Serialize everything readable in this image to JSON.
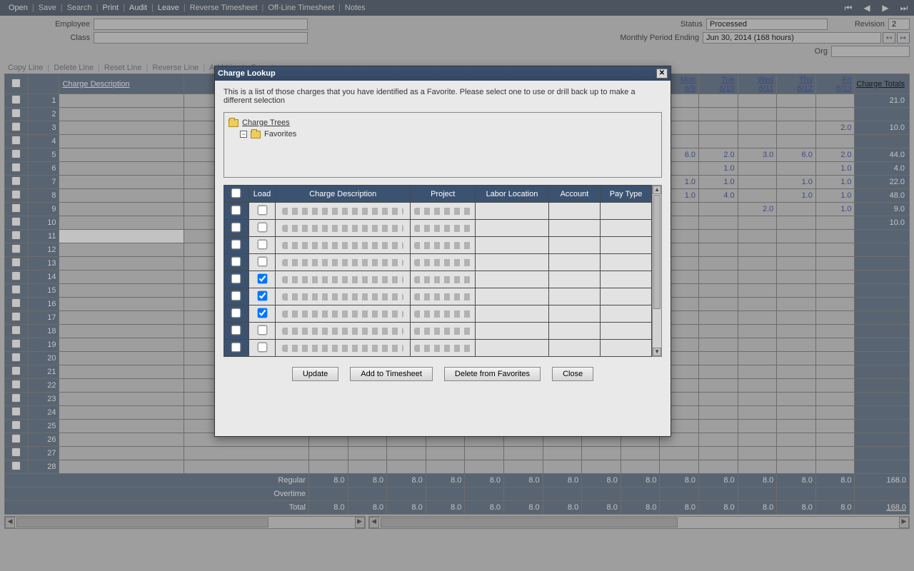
{
  "toolbar": {
    "items": [
      "Open",
      "Save",
      "Search",
      "Print",
      "Audit",
      "Leave",
      "Reverse Timesheet",
      "Off-Line Timesheet",
      "Notes"
    ],
    "active": [
      true,
      false,
      false,
      true,
      true,
      true,
      false,
      false,
      false
    ]
  },
  "info": {
    "employee_label": "Employee",
    "employee_value": "",
    "class_label": "Class",
    "class_value": "",
    "status_label": "Status",
    "status_value": "Processed",
    "revision_label": "Revision",
    "revision_value": "2",
    "period_label": "Monthly Period Ending",
    "period_value": "Jun 30, 2014 (168 hours)",
    "org_label": "Org",
    "org_value": ""
  },
  "line_actions": [
    "Copy Line",
    "Delete Line",
    "Reset Line",
    "Reverse Line",
    "Add Line to Favorites"
  ],
  "ts_header": {
    "charge_desc": "Charge Description",
    "mon": "Mon",
    "mon_d": "6/9",
    "tue": "Tue",
    "tue_d": "6/10",
    "wed": "Wed",
    "wed_d": "6/11",
    "thu": "Thu",
    "thu_d": "6/12",
    "fri": "Fri",
    "fri_d": "6/13",
    "totals": "Charge Totals"
  },
  "rows": [
    {
      "n": "1",
      "mon": "",
      "tue": "",
      "wed": "",
      "thu": "",
      "fri": "",
      "tot": "21.0"
    },
    {
      "n": "2",
      "mon": "",
      "tue": "",
      "wed": "",
      "thu": "",
      "fri": "",
      "tot": ""
    },
    {
      "n": "3",
      "mon": "",
      "tue": "",
      "wed": "",
      "thu": "",
      "fri": "2.0",
      "tot": "10.0"
    },
    {
      "n": "4",
      "mon": "",
      "tue": "",
      "wed": "",
      "thu": "",
      "fri": "",
      "tot": ""
    },
    {
      "n": "5",
      "mon": "6.0",
      "tue": "2.0",
      "wed": "3.0",
      "thu": "6.0",
      "fri": "2.0",
      "tot": "44.0"
    },
    {
      "n": "6",
      "mon": "",
      "tue": "1.0",
      "wed": "",
      "thu": "",
      "fri": "1.0",
      "tot": "4.0"
    },
    {
      "n": "7",
      "mon": "1.0",
      "tue": "1.0",
      "wed": "",
      "thu": "1.0",
      "fri": "1.0",
      "tot": "22.0"
    },
    {
      "n": "8",
      "mon": "1.0",
      "tue": "4.0",
      "wed": "",
      "thu": "1.0",
      "fri": "1.0",
      "tot": "48.0"
    },
    {
      "n": "9",
      "mon": "",
      "tue": "",
      "wed": "2.0",
      "thu": "",
      "fri": "1.0",
      "tot": "9.0"
    },
    {
      "n": "10",
      "mon": "",
      "tue": "",
      "wed": "",
      "thu": "",
      "fri": "",
      "tot": "10.0"
    },
    {
      "n": "11",
      "mon": "",
      "tue": "",
      "wed": "",
      "thu": "",
      "fri": "",
      "tot": ""
    },
    {
      "n": "12",
      "mon": "",
      "tue": "",
      "wed": "",
      "thu": "",
      "fri": "",
      "tot": ""
    },
    {
      "n": "13",
      "mon": "",
      "tue": "",
      "wed": "",
      "thu": "",
      "fri": "",
      "tot": ""
    },
    {
      "n": "14",
      "mon": "",
      "tue": "",
      "wed": "",
      "thu": "",
      "fri": "",
      "tot": ""
    },
    {
      "n": "15",
      "mon": "",
      "tue": "",
      "wed": "",
      "thu": "",
      "fri": "",
      "tot": ""
    },
    {
      "n": "16",
      "mon": "",
      "tue": "",
      "wed": "",
      "thu": "",
      "fri": "",
      "tot": ""
    },
    {
      "n": "17",
      "mon": "",
      "tue": "",
      "wed": "",
      "thu": "",
      "fri": "",
      "tot": ""
    },
    {
      "n": "18",
      "mon": "",
      "tue": "",
      "wed": "",
      "thu": "",
      "fri": "",
      "tot": ""
    },
    {
      "n": "19",
      "mon": "",
      "tue": "",
      "wed": "",
      "thu": "",
      "fri": "",
      "tot": ""
    },
    {
      "n": "20",
      "mon": "",
      "tue": "",
      "wed": "",
      "thu": "",
      "fri": "",
      "tot": ""
    },
    {
      "n": "21",
      "mon": "",
      "tue": "",
      "wed": "",
      "thu": "",
      "fri": "",
      "tot": ""
    },
    {
      "n": "22",
      "mon": "",
      "tue": "",
      "wed": "",
      "thu": "",
      "fri": "",
      "tot": ""
    },
    {
      "n": "23",
      "mon": "",
      "tue": "",
      "wed": "",
      "thu": "",
      "fri": "",
      "tot": ""
    },
    {
      "n": "24",
      "mon": "",
      "tue": "",
      "wed": "",
      "thu": "",
      "fri": "",
      "tot": ""
    },
    {
      "n": "25",
      "mon": "",
      "tue": "",
      "wed": "",
      "thu": "",
      "fri": "",
      "tot": ""
    },
    {
      "n": "26",
      "mon": "",
      "tue": "",
      "wed": "",
      "thu": "",
      "fri": "",
      "tot": ""
    },
    {
      "n": "27",
      "mon": "",
      "tue": "",
      "wed": "",
      "thu": "",
      "fri": "",
      "tot": ""
    },
    {
      "n": "28",
      "mon": "",
      "tue": "",
      "wed": "",
      "thu": "",
      "fri": "",
      "tot": ""
    }
  ],
  "footer": {
    "regular_label": "Regular",
    "overtime_label": "Overtime",
    "total_label": "Total",
    "day_totals": [
      "8.0",
      "8.0",
      "8.0",
      "8.0",
      "8.0",
      "8.0",
      "8.0",
      "8.0",
      "8.0",
      "8.0",
      "8.0",
      "8.0",
      "8.0",
      "8.0"
    ],
    "grand_total": "168.0"
  },
  "modal": {
    "title": "Charge Lookup",
    "instructions": "This is a list of those charges that you have identified as a Favorite. Please select one to use or drill back up to make a different selection",
    "tree": {
      "root": "Charge Trees",
      "fav": "Favorites"
    },
    "cols": {
      "load": "Load",
      "desc": "Charge Description",
      "proj": "Project",
      "loc": "Labor Location",
      "acct": "Account",
      "pay": "Pay Type"
    },
    "row_checks": [
      false,
      false,
      false,
      false,
      true,
      true,
      true,
      false,
      false
    ],
    "buttons": {
      "update": "Update",
      "add": "Add to Timesheet",
      "del": "Delete from Favorites",
      "close": "Close"
    }
  }
}
